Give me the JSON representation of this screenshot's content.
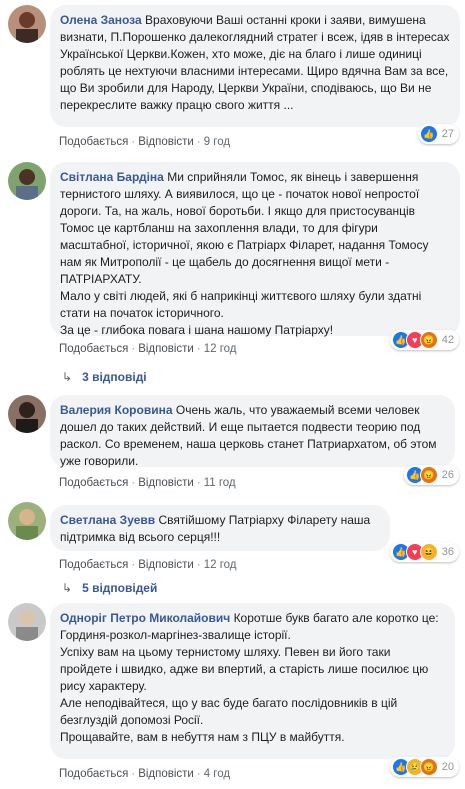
{
  "actions": {
    "like": "Подобається",
    "reply": "Відповісти",
    "sep": "·"
  },
  "comments": [
    {
      "author": "Олена Заноза",
      "text": "Враховуючи Ваші останні кроки і заяви, вимушена визнати, П.Порошенко далекоглядний стратег і всеж, ідяв в інтересах Української Церкви.Кожен, хто може, діє на благо і лише одиниці роблять це нехтуючи власними інтересами. Щиро вдячна Вам за все, що Ви зробили для Народу, Церкви України, сподіваюсь, що Ви не перекреслите важку працю свого життя ...",
      "time": "9 год",
      "react_count": "27",
      "reactions": [
        "like-icon"
      ]
    },
    {
      "author": "Світлана Бардіна",
      "text": "Ми сприйняли Томос, як вінець і завершення тернистого шляху. А виявилося, що це - початок нової непростої дороги. Та, на жаль, нової боротьби. І якщо для пристосуванців Томос це картбланш на захоплення влади, то для фігури масштабної, історичної, якою є Патріарх Філарет, надання Томосу нам як Митрополії - це щабель до досягнення вищої мети - ПАТРІАРХАТУ.\nМало у світі людей, які б наприкінці життєвого шляху були здатні стати на початок історичного.\nЗа це - глибока повага і шана нашому Патріарху!",
      "time": "12 год",
      "react_count": "42",
      "reactions": [
        "like-icon",
        "love-icon",
        "angry-icon"
      ],
      "replies": "3 відповіді"
    },
    {
      "author": "Валерия Коровина",
      "text": "Очень жаль, что уважаемый всеми человек дошел до таких действий. И еще пытается подвести теорию под раскол. Со временем, наша церковь станет Патриархатом, об этом уже говорили.",
      "time": "11 год",
      "react_count": "26",
      "reactions": [
        "like-icon",
        "angry-icon"
      ]
    },
    {
      "author": "Светлана Зуевв",
      "text": "Святійшому Патріарху Філарету наша підтримка від всього серця!!!",
      "time": "12 год",
      "react_count": "36",
      "reactions": [
        "like-icon",
        "love-icon",
        "haha-icon"
      ],
      "replies": "5 відповідей"
    },
    {
      "author": "Одноріг Петро Миколайович",
      "text": "Коротше букв багато але коротко це:\nГординя-розкол-маргінез-звалище історії.\nУспіху вам на цьому тернистому шляху. Певен ви його таки пройдете і швидко, адже ви впертий, а старість лише посилює цю рису характеру.\nАле неподівайтеся, що у вас буде багато послідовників в цій безглуздій допомозі Росії.\nПрощавайте, вам в небуття нам з ПЦУ в майбуття.",
      "time": "4 год",
      "react_count": "20",
      "reactions": [
        "like-icon",
        "sad-icon",
        "angry-icon"
      ]
    }
  ]
}
